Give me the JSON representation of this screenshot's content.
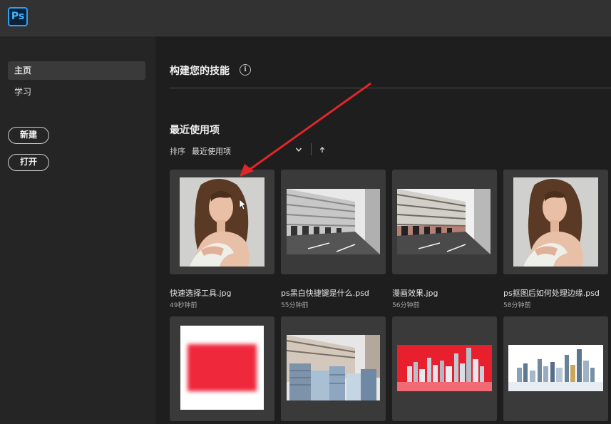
{
  "app": {
    "logo_text": "Ps"
  },
  "sidebar": {
    "items": [
      {
        "label": "主页",
        "active": true
      },
      {
        "label": "学习",
        "active": false
      }
    ],
    "new_label": "新建",
    "open_label": "打开"
  },
  "main": {
    "build_heading": "构建您的技能",
    "info_icon": "i",
    "recent_heading": "最近使用项",
    "sort_label": "排序",
    "sort_value": "最近使用项",
    "files": [
      {
        "name": "快速选择工具.jpg",
        "time": "49秒钟前",
        "thumb": "portrait"
      },
      {
        "name": "ps黑白快捷键是什么.psd",
        "time": "55分钟前",
        "thumb": "street-bw"
      },
      {
        "name": "漫画效果.jpg",
        "time": "56分钟前",
        "thumb": "street-comic"
      },
      {
        "name": "ps抠图后如何处理边缘.psd",
        "time": "58分钟前",
        "thumb": "portrait"
      },
      {
        "name": "",
        "time": "",
        "thumb": "red-rect"
      },
      {
        "name": "",
        "time": "",
        "thumb": "street-city"
      },
      {
        "name": "",
        "time": "",
        "thumb": "skyline-red"
      },
      {
        "name": "",
        "time": "",
        "thumb": "skyline-white"
      }
    ]
  },
  "colors": {
    "accent_ps": "#2ea0f5",
    "annotation_arrow": "#e0262a",
    "thumb_red": "#f0283c"
  }
}
